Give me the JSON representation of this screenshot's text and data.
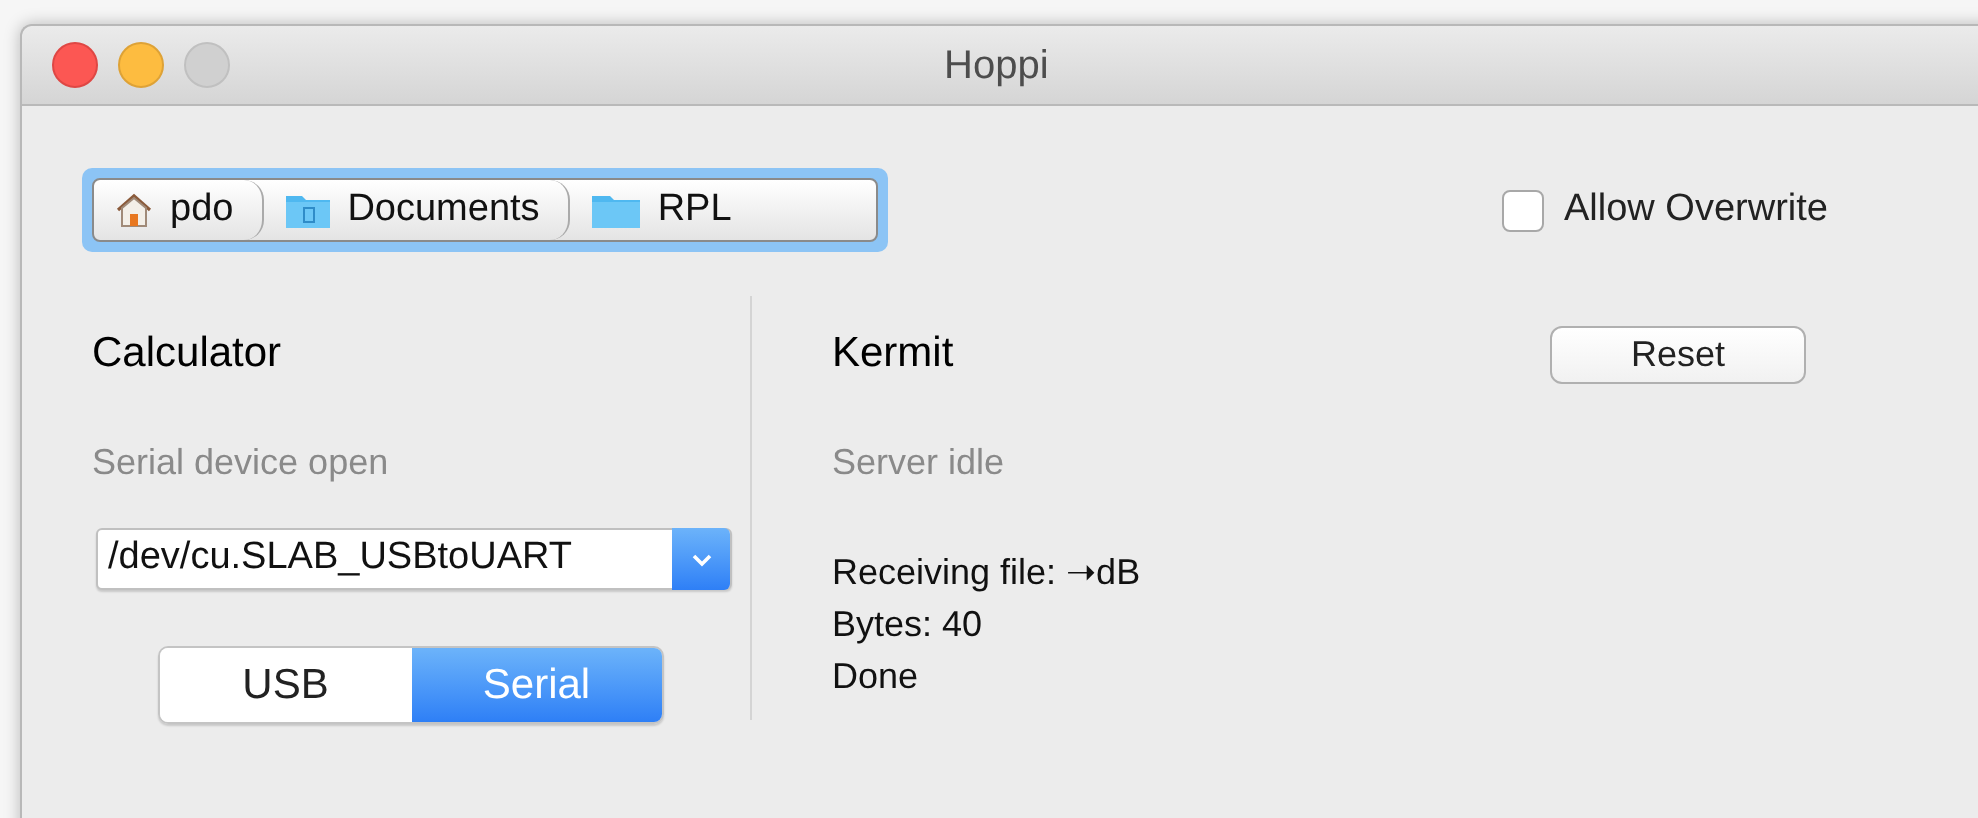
{
  "window": {
    "title": "Hoppi"
  },
  "path": [
    {
      "label": "pdo",
      "kind": "home"
    },
    {
      "label": "Documents",
      "kind": "documents"
    },
    {
      "label": "RPL",
      "kind": "folder"
    }
  ],
  "allow_overwrite": {
    "label": "Allow Overwrite",
    "checked": false
  },
  "calculator": {
    "title": "Calculator",
    "status": "Serial device open",
    "device": "/dev/cu.SLAB_USBtoUART",
    "modes": [
      {
        "label": "USB",
        "selected": false
      },
      {
        "label": "Serial",
        "selected": true
      }
    ]
  },
  "kermit": {
    "title": "Kermit",
    "reset": "Reset",
    "status": "Server idle",
    "log": [
      "Receiving file: ➝dB",
      "Bytes: 40",
      "Done"
    ]
  }
}
